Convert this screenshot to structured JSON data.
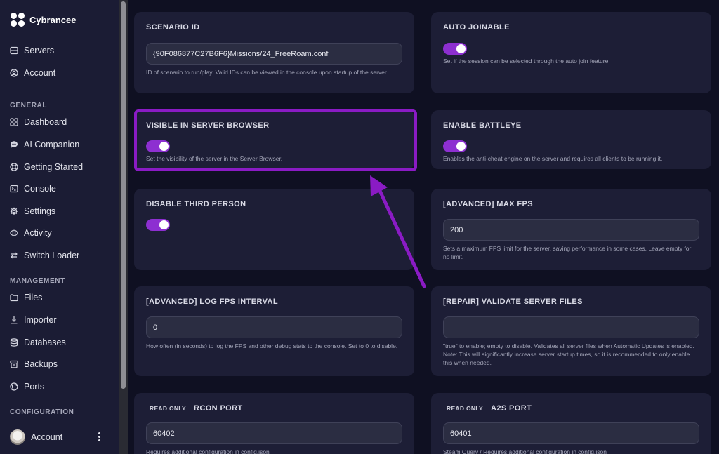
{
  "brand": {
    "name": "Cybrancee"
  },
  "sidebar": {
    "top_items": [
      {
        "label": "Servers",
        "icon": "server-icon"
      },
      {
        "label": "Account",
        "icon": "user-icon"
      }
    ],
    "sections": [
      {
        "label": "GENERAL",
        "items": [
          {
            "label": "Dashboard",
            "icon": "grid-icon"
          },
          {
            "label": "AI Companion",
            "icon": "chat-icon"
          },
          {
            "label": "Getting Started",
            "icon": "lifebuoy-icon"
          },
          {
            "label": "Console",
            "icon": "terminal-icon"
          },
          {
            "label": "Settings",
            "icon": "gear-icon"
          },
          {
            "label": "Activity",
            "icon": "eye-icon"
          },
          {
            "label": "Switch Loader",
            "icon": "swap-icon"
          }
        ]
      },
      {
        "label": "MANAGEMENT",
        "items": [
          {
            "label": "Files",
            "icon": "folder-icon"
          },
          {
            "label": "Importer",
            "icon": "download-icon"
          },
          {
            "label": "Databases",
            "icon": "database-icon"
          },
          {
            "label": "Backups",
            "icon": "archive-icon"
          },
          {
            "label": "Ports",
            "icon": "globe-icon"
          }
        ]
      },
      {
        "label": "CONFIGURATION",
        "items": []
      }
    ],
    "account_label": "Account"
  },
  "cards": {
    "scenario_id": {
      "title": "SCENARIO ID",
      "value": "{90F086877C27B6F6}Missions/24_FreeRoam.conf",
      "description": "ID of scenario to run/play. Valid IDs can be viewed in the console upon startup of the server."
    },
    "auto_joinable": {
      "title": "AUTO JOINABLE",
      "enabled": true,
      "description": "Set if the session can be selected through the auto join feature."
    },
    "visible_in_browser": {
      "title": "VISIBLE IN SERVER BROWSER",
      "enabled": true,
      "description": "Set the visibility of the server in the Server Browser."
    },
    "enable_battleye": {
      "title": "ENABLE BATTLEYE",
      "enabled": true,
      "description": "Enables the anti-cheat engine on the server and requires all clients to be running it."
    },
    "disable_third_person": {
      "title": "DISABLE THIRD PERSON",
      "enabled": true
    },
    "max_fps": {
      "title": "[ADVANCED] MAX FPS",
      "value": "200",
      "description": "Sets a maximum FPS limit for the server, saving performance in some cases. Leave empty for no limit."
    },
    "log_fps_interval": {
      "title": "[ADVANCED] LOG FPS INTERVAL",
      "value": "0",
      "description": "How often (in seconds) to log the FPS and other debug stats to the console. Set to 0 to disable."
    },
    "validate_files": {
      "title": "[REPAIR] VALIDATE SERVER FILES",
      "value": "",
      "description": "\"true\" to enable; empty to disable. Validates all server files when Automatic Updates is enabled. Note: This will significantly increase server startup times, so it is recommended to only enable this when needed."
    },
    "rcon_port": {
      "badge": "READ ONLY",
      "title": "RCON PORT",
      "value": "60402",
      "description": "Requires additional configuration in config.json"
    },
    "a2s_port": {
      "badge": "READ ONLY",
      "title": "A2S PORT",
      "value": "60401",
      "description": "Steam Query / Requires additional configuration in config.json"
    }
  },
  "colors": {
    "accent": "#8d2fd1",
    "highlight": "#8a1bc4",
    "background": "#0f1022",
    "card": "#1d1e36",
    "sidebar": "#1b1c34"
  }
}
